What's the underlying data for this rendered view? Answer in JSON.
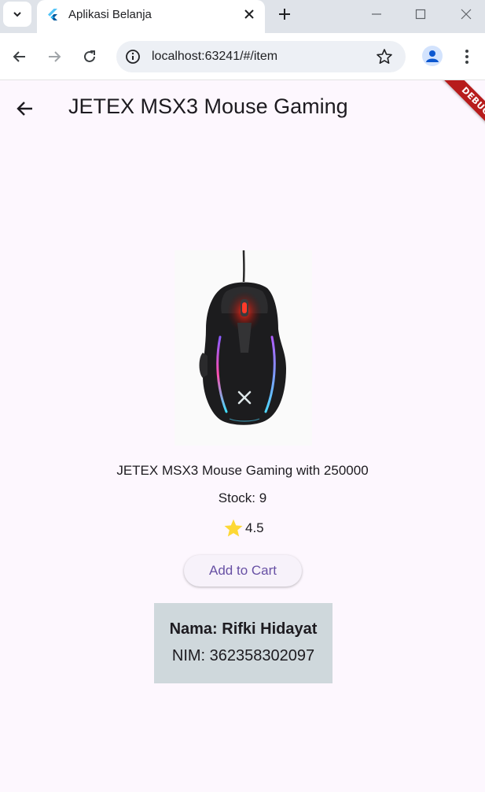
{
  "browser": {
    "tab_title": "Aplikasi Belanja",
    "url": "localhost:63241/#/item"
  },
  "app": {
    "title": "JETEX MSX3 Mouse Gaming",
    "debug_banner": "DEBUG"
  },
  "product": {
    "description": "JETEX MSX3 Mouse Gaming with 250000",
    "stock_text": "Stock: 9",
    "rating": "4.5",
    "add_to_cart_label": "Add to Cart"
  },
  "student": {
    "name_text": "Nama: Rifki Hidayat",
    "nim_text": "NIM: 362358302097"
  },
  "colors": {
    "background": "#fdf7fe",
    "accent": "#6750a4",
    "card": "#cfd8dc",
    "star": "#fdd835",
    "debug": "#b71c1c"
  },
  "icons": [
    "tab-dropdown-icon",
    "flutter-icon",
    "close-icon",
    "plus-icon",
    "minimize-icon",
    "maximize-icon",
    "window-close-icon",
    "back-arrow-icon",
    "forward-arrow-icon",
    "reload-icon",
    "info-icon",
    "star-outline-icon",
    "profile-icon",
    "menu-dots-icon",
    "star-icon"
  ]
}
